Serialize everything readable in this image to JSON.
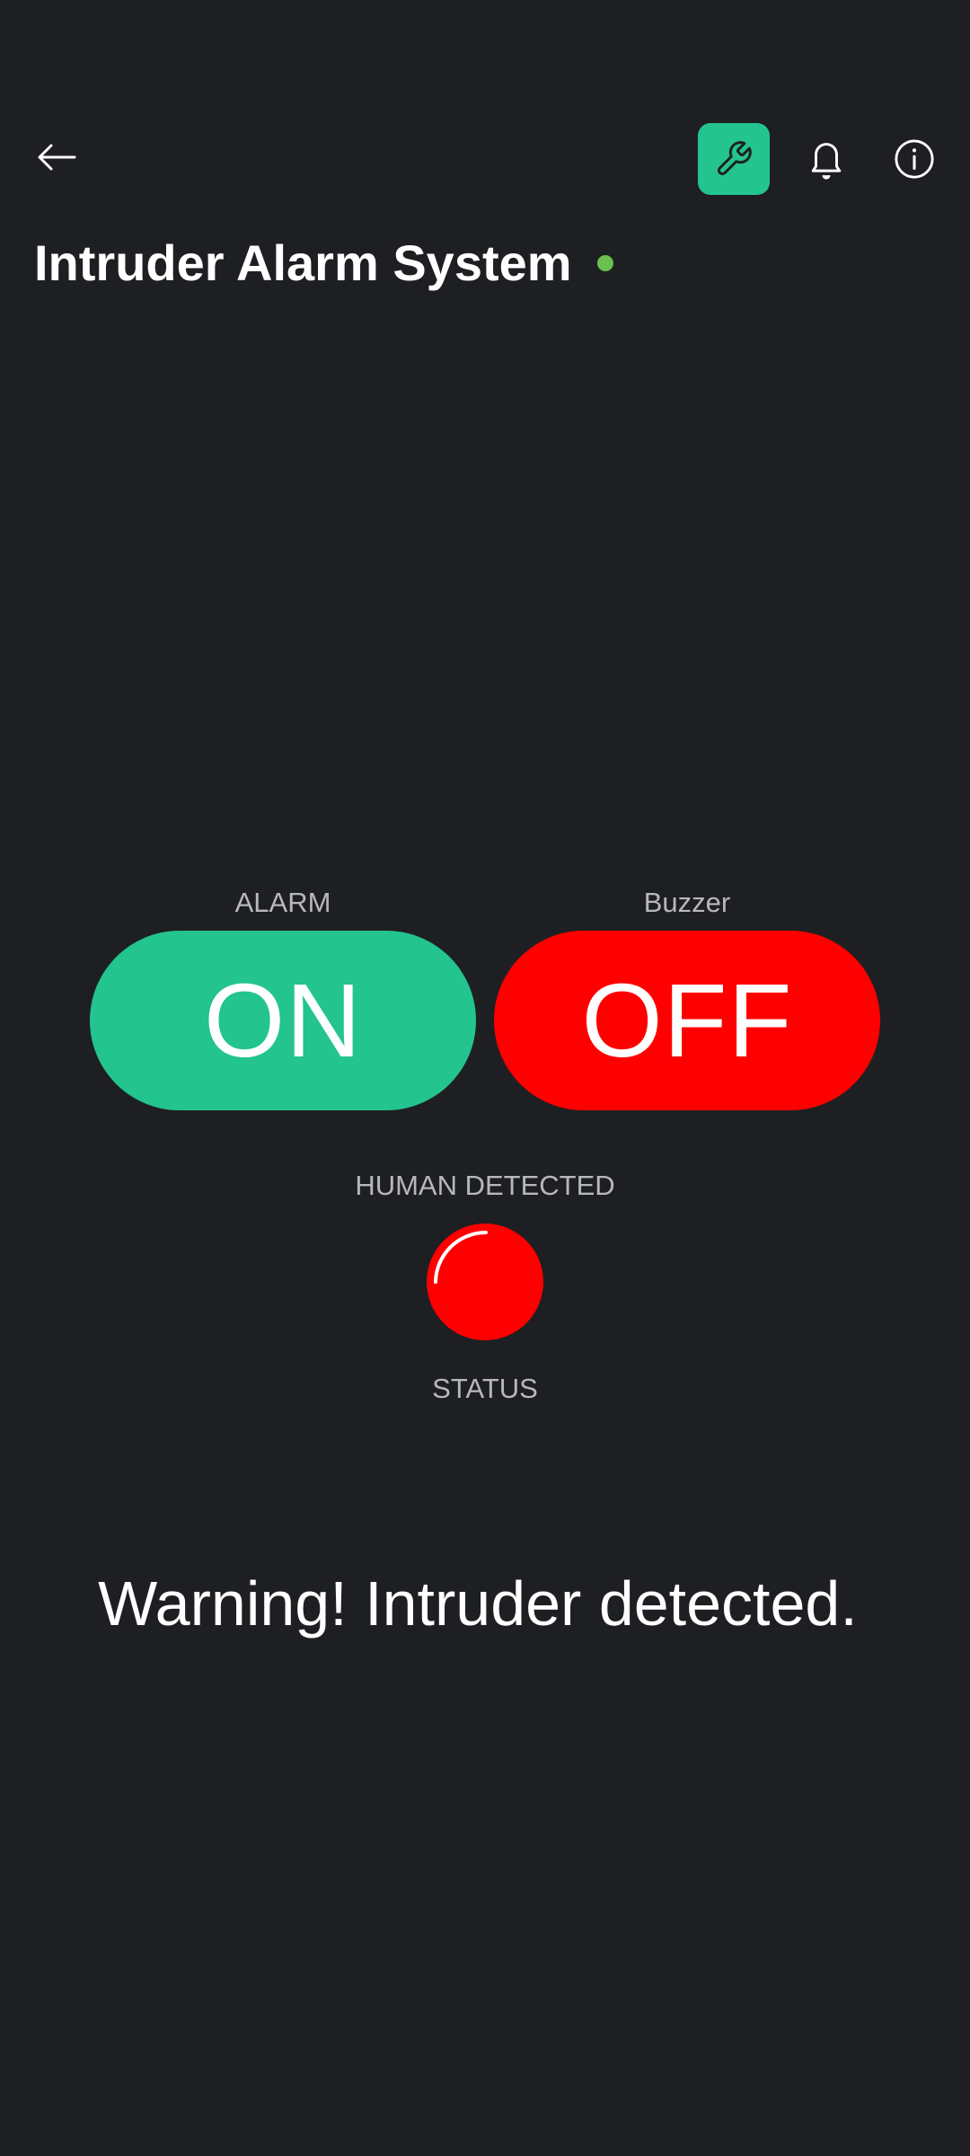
{
  "header": {
    "back_icon": "arrow-left-icon",
    "actions": [
      {
        "icon": "wrench-icon",
        "color": "#23c48e"
      },
      {
        "icon": "bell-icon"
      },
      {
        "icon": "info-icon"
      }
    ],
    "title": "Intruder Alarm System",
    "online_color": "#6bc04f"
  },
  "widgets": {
    "alarm": {
      "label": "ALARM",
      "value": "ON",
      "color": "#23c48e"
    },
    "buzzer": {
      "label": "Buzzer",
      "value": "OFF",
      "color": "#ff0000"
    },
    "human_detected": {
      "label": "HUMAN DETECTED",
      "color": "#ff0000"
    },
    "status_label": "STATUS"
  },
  "message": "Warning! Intruder detected."
}
